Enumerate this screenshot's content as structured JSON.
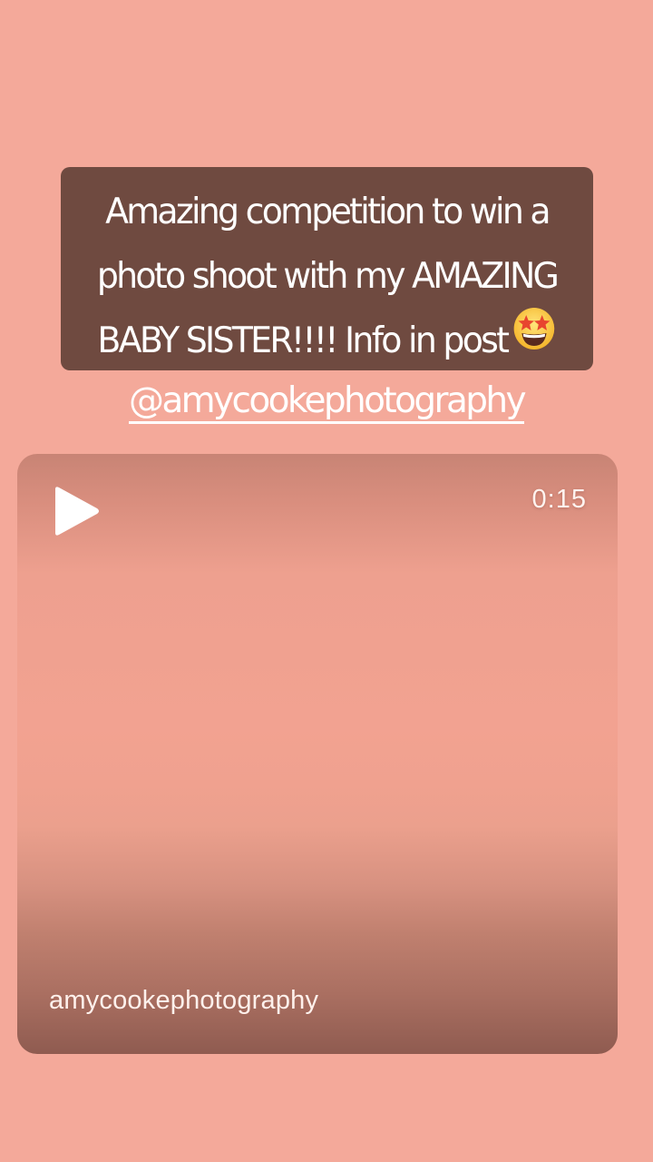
{
  "story": {
    "caption_lines": [
      "Amazing competition to win a",
      "photo shoot with my AMAZING",
      "BABY SISTER!!!! Info in post"
    ],
    "caption_emoji": "star-struck-emoji",
    "mention": "@amycookephotography",
    "colors": {
      "background": "#f4a99a",
      "caption_box": "#6f4a40",
      "text": "#ffffff"
    }
  },
  "video": {
    "duration": "0:15",
    "username": "amycookephotography",
    "play_icon": "play-icon"
  }
}
